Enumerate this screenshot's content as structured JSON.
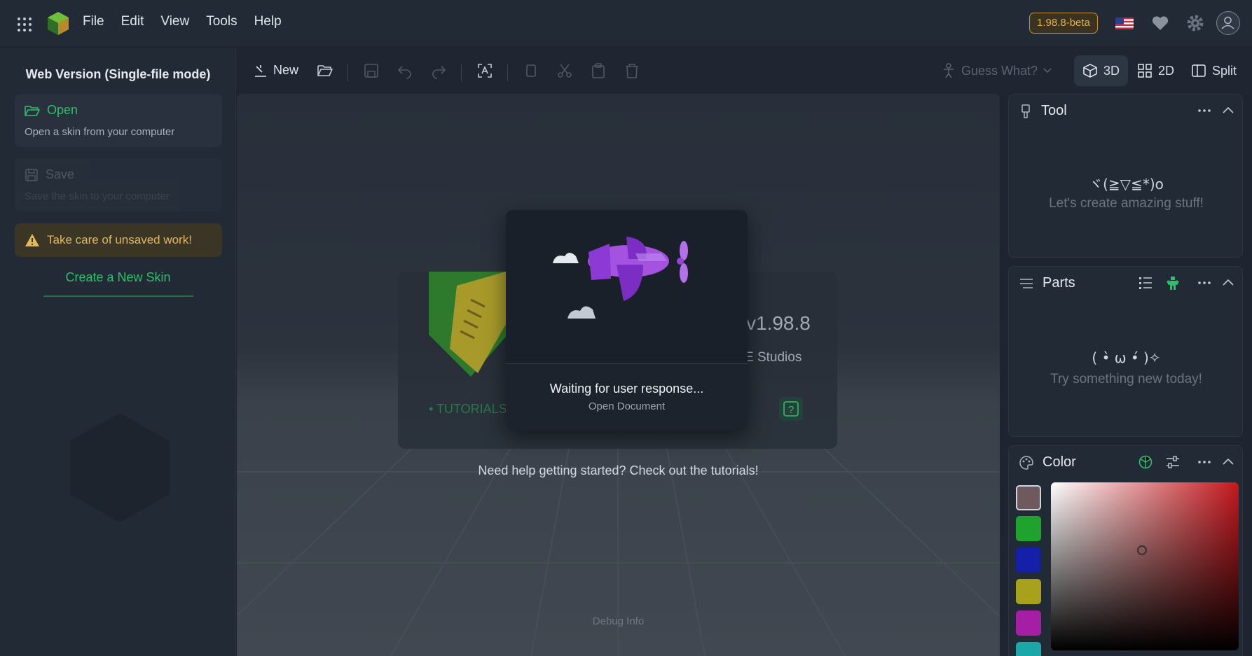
{
  "menu": [
    "File",
    "Edit",
    "View",
    "Tools",
    "Help"
  ],
  "version_badge": "1.98.8-beta",
  "sidebar": {
    "title": "Web Version (Single-file mode)",
    "open": {
      "label": "Open",
      "sub": "Open a skin from your computer"
    },
    "save": {
      "label": "Save",
      "sub": "Save the skin to your computer"
    },
    "warning": "Take care of unsaved work!",
    "create_link": "Create a New Skin"
  },
  "toolbar": {
    "new_label": "New",
    "guess_label": "Guess What?",
    "views": [
      "3D",
      "2D",
      "Split"
    ]
  },
  "viewport": {
    "behind_version": "v1.98.8",
    "behind_studio": "E Studios",
    "behind_tutorials": "TUTORIALS",
    "help_text": "Need help getting started? Check out the tutorials!",
    "debug": "Debug Info"
  },
  "modal": {
    "title": "Waiting for user response...",
    "subtitle": "Open Document"
  },
  "panels": {
    "tool": {
      "title": "Tool",
      "kaomoji": "ヾ(≧▽≦*)o",
      "text": "Let's create amazing stuff!"
    },
    "parts": {
      "title": "Parts",
      "kaomoji": "( •̀ ω •́ )✧",
      "text": "Try something new today!"
    },
    "color": {
      "title": "Color",
      "swatches": [
        "#6e5a5d",
        "#1fa22e",
        "#1420a8",
        "#a7a11b",
        "#a51fa5",
        "#1ba7a7"
      ]
    }
  },
  "colors": {
    "accent": "#2fbf6a",
    "warning": "#e4b757",
    "badge": "#c9922b"
  }
}
